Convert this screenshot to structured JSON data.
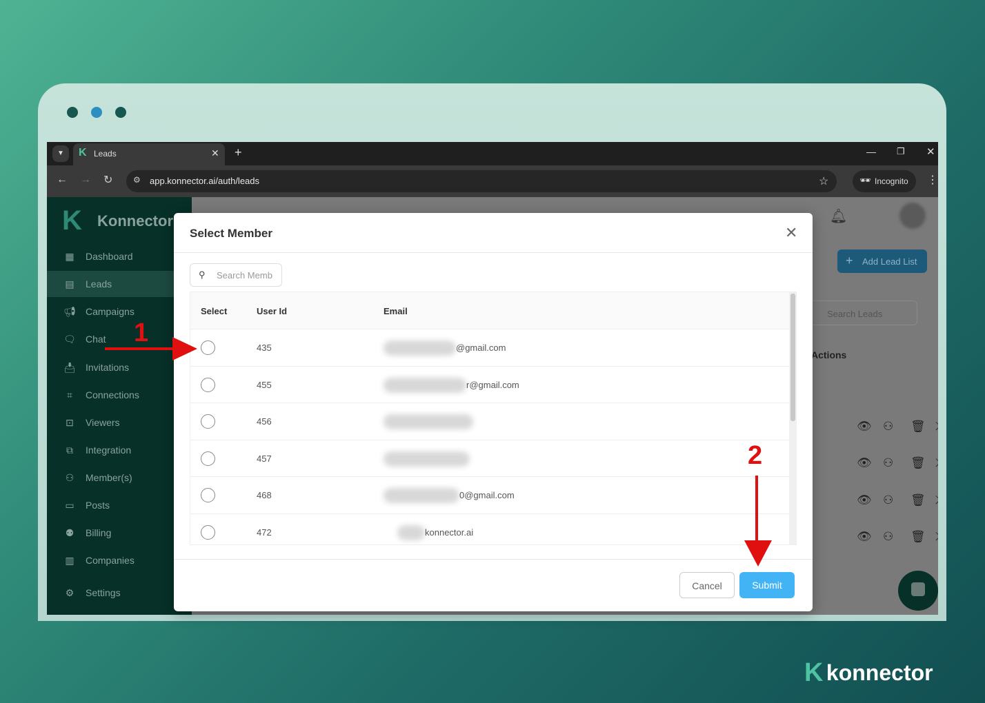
{
  "browser": {
    "tab_title": "Leads",
    "url": "app.konnector.ai/auth/leads",
    "incognito_label": "Incognito"
  },
  "app": {
    "brand": "Konnector",
    "add_lead_list": "Add Lead List",
    "search_leads_placeholder": "Search Leads",
    "actions_header": "Actions"
  },
  "sidebar": {
    "items": [
      {
        "label": "Dashboard",
        "icon": "dashboard-icon"
      },
      {
        "label": "Leads",
        "icon": "leads-icon",
        "active": true
      },
      {
        "label": "Campaigns",
        "icon": "megaphone-icon"
      },
      {
        "label": "Chat",
        "icon": "chat-icon"
      },
      {
        "label": "Invitations",
        "icon": "inbox-icon"
      },
      {
        "label": "Connections",
        "icon": "connections-icon"
      },
      {
        "label": "Viewers",
        "icon": "viewers-icon"
      },
      {
        "label": "Integration",
        "icon": "integration-icon"
      },
      {
        "label": "Member(s)",
        "icon": "members-icon"
      },
      {
        "label": "Posts",
        "icon": "posts-icon"
      },
      {
        "label": "Billing",
        "icon": "billing-icon"
      },
      {
        "label": "Companies",
        "icon": "building-icon"
      },
      {
        "label": "Settings",
        "icon": "gear-icon"
      }
    ]
  },
  "modal": {
    "title": "Select Member",
    "search_placeholder": "Search Memb",
    "columns": [
      "Select",
      "User Id",
      "Email"
    ],
    "rows": [
      {
        "user_id": "435",
        "email": "@gmail.com"
      },
      {
        "user_id": "455",
        "email": "r@gmail.com"
      },
      {
        "user_id": "456",
        "email": ""
      },
      {
        "user_id": "457",
        "email": ""
      },
      {
        "user_id": "468",
        "email": "0@gmail.com"
      },
      {
        "user_id": "472",
        "email": "konnector.ai"
      }
    ],
    "cancel": "Cancel",
    "submit": "Submit"
  },
  "annotations": {
    "step1": "1",
    "step2": "2"
  },
  "footer_logo": "konnector",
  "colors": {
    "accent": "#42b4f5",
    "annotation": "#e01010",
    "sidebar": "#063028",
    "brand": "#4fc3a1"
  }
}
